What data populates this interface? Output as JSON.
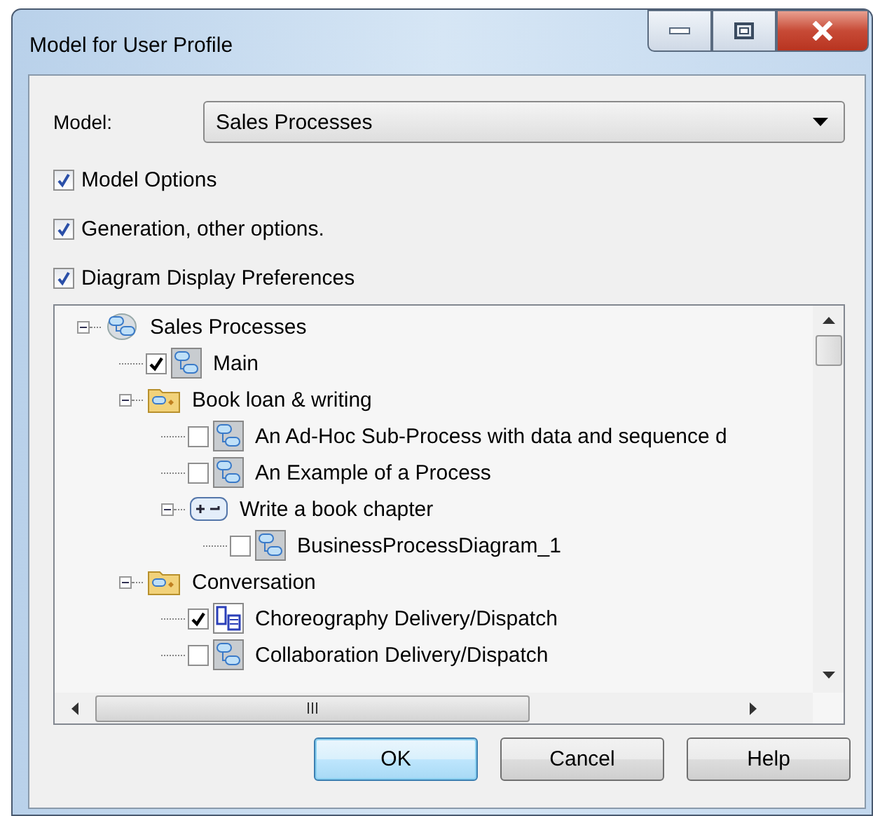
{
  "window": {
    "title": "Model for User Profile"
  },
  "model_field": {
    "label": "Model:",
    "value": "Sales Processes"
  },
  "options": [
    {
      "label": "Model Options",
      "checked": true
    },
    {
      "label": "Generation, other options.",
      "checked": true
    },
    {
      "label": "Diagram Display Preferences",
      "checked": true
    }
  ],
  "tree": [
    {
      "kind": "model",
      "label": "Sales Processes",
      "expanded": true,
      "children": [
        {
          "kind": "process-diagram",
          "label": "Main",
          "checked": true
        },
        {
          "kind": "folder",
          "label": "Book loan & writing",
          "expanded": true,
          "children": [
            {
              "kind": "process-diagram",
              "label": "An Ad-Hoc Sub-Process with data and sequence d",
              "checked": false
            },
            {
              "kind": "process-diagram",
              "label": "An Example of a Process",
              "checked": false
            },
            {
              "kind": "process",
              "label": "Write a book chapter",
              "expanded": true,
              "children": [
                {
                  "kind": "process-diagram",
                  "label": "BusinessProcessDiagram_1",
                  "checked": false
                }
              ]
            }
          ]
        },
        {
          "kind": "folder",
          "label": "Conversation",
          "expanded": true,
          "children": [
            {
              "kind": "choreography-diagram",
              "label": "Choreography Delivery/Dispatch",
              "checked": true
            },
            {
              "kind": "process-diagram",
              "label": "Collaboration Delivery/Dispatch",
              "checked": false
            }
          ]
        }
      ]
    }
  ],
  "buttons": [
    {
      "label": "OK",
      "default": true
    },
    {
      "label": "Cancel",
      "default": false
    },
    {
      "label": "Help",
      "default": false
    }
  ]
}
